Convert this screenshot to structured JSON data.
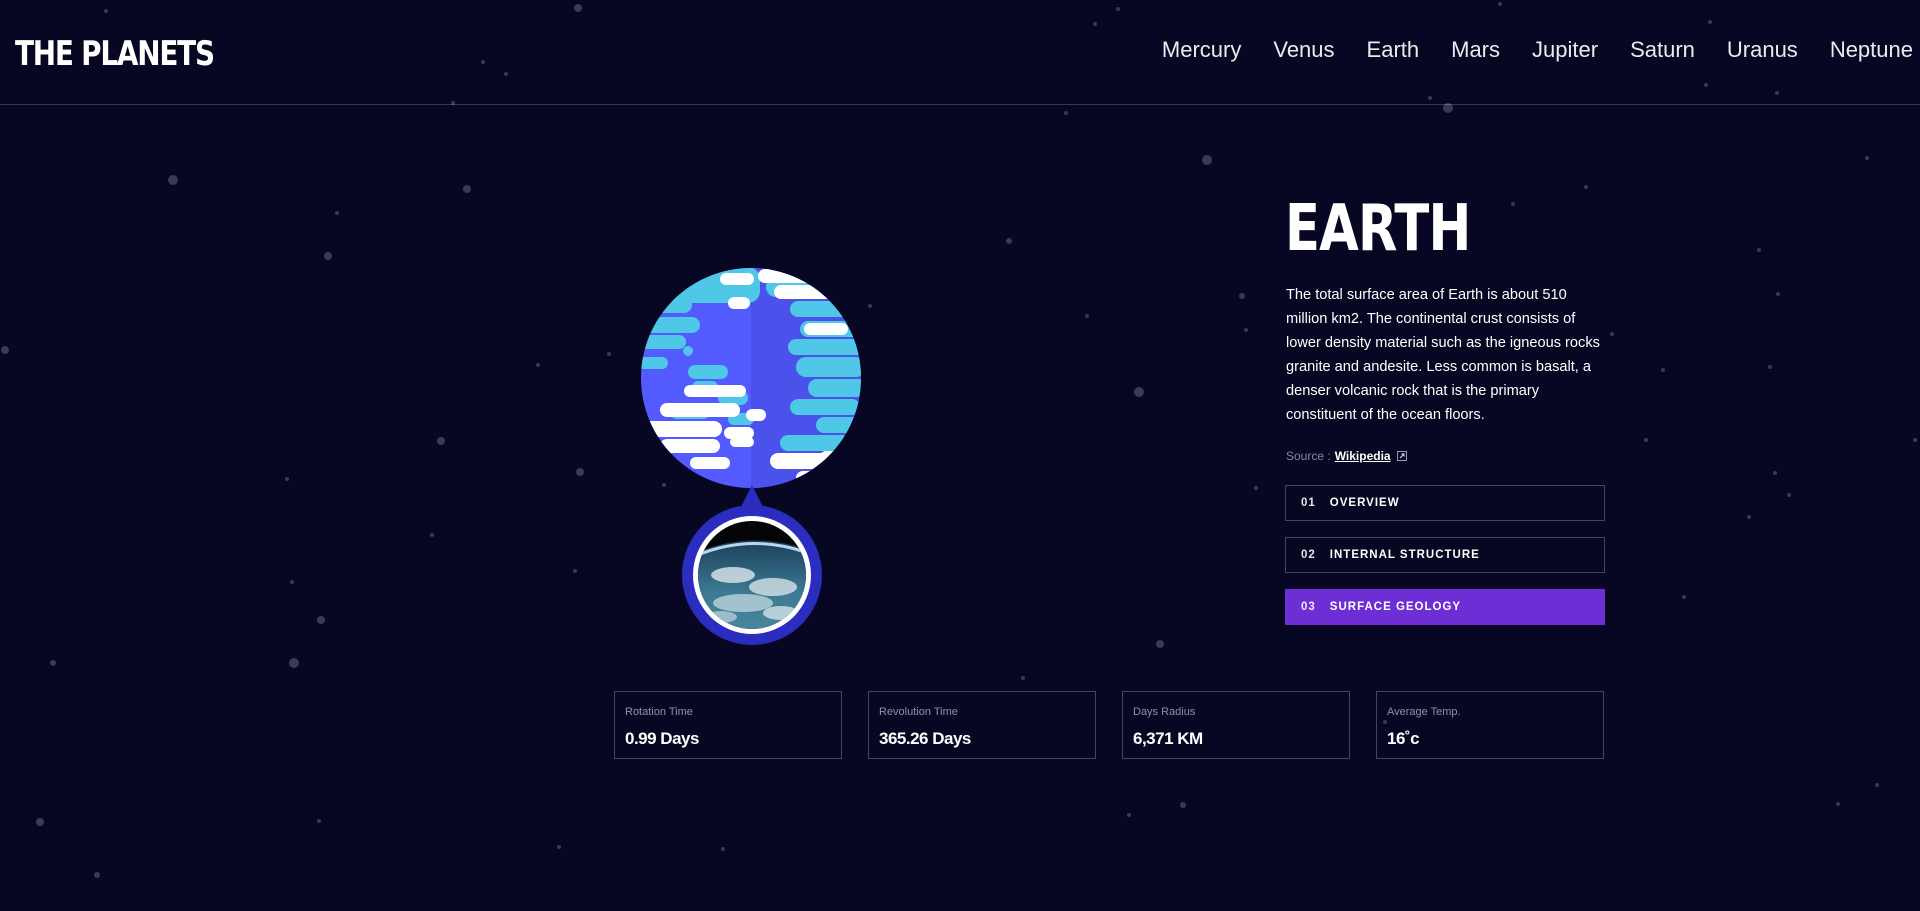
{
  "logo": "THE PLANETS",
  "nav": [
    "Mercury",
    "Venus",
    "Earth",
    "Mars",
    "Jupiter",
    "Saturn",
    "Uranus",
    "Neptune"
  ],
  "planet": {
    "name": "EARTH",
    "description": "The total surface area of Earth is about 510 million km2. The continental crust consists of lower density material such as the igneous rocks granite and andesite. Less common is basalt, a denser volcanic rock that is the primary constituent of the ocean floors.",
    "source_prefix": "Source :",
    "source_link": "Wikipedia"
  },
  "tabs": [
    {
      "num": "01",
      "label": "OVERVIEW"
    },
    {
      "num": "02",
      "label": "INTERNAL STRUCTURE"
    },
    {
      "num": "03",
      "label": "SURFACE GEOLOGY"
    }
  ],
  "active_tab": "03",
  "stats": [
    {
      "label": "Rotation Time",
      "value": "0.99 Days"
    },
    {
      "label": "Revolution Time",
      "value": "365.26 Days"
    },
    {
      "label": "Days Radius",
      "value": "6,371 KM"
    },
    {
      "label": "Average Temp.",
      "value": "16˚c"
    }
  ],
  "colors": {
    "background": "#070724",
    "accent": "#6d2ed5",
    "planet_blue": "#545bfe",
    "planet_cyan": "#4fc7e7",
    "ring_blue": "#2a2dbd"
  },
  "icons": {
    "external_link": "external-link-icon"
  }
}
